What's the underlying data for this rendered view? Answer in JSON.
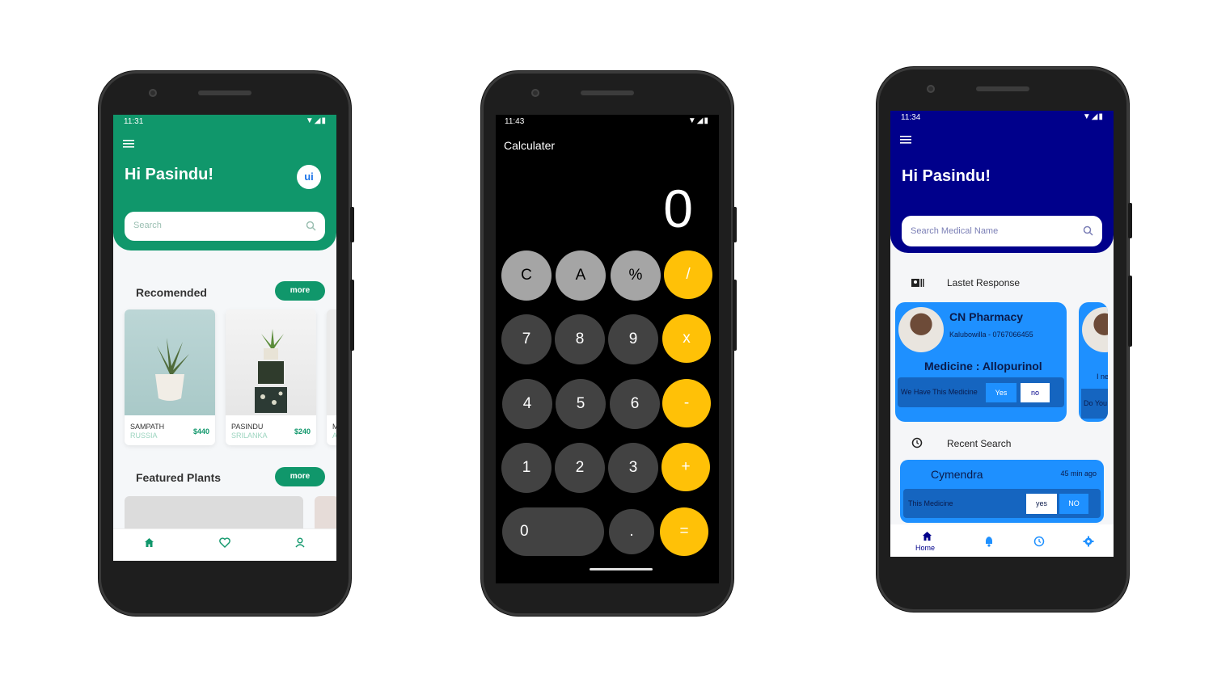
{
  "plants_app": {
    "status_time": "11:31",
    "greeting": "Hi Pasindu!",
    "search_placeholder": "Search",
    "recommended_title": "Recomended",
    "featured_title": "Featured Plants",
    "more_label": "more",
    "cards": [
      {
        "name": "SAMPATH",
        "country": "RUSSIA",
        "price": "$440"
      },
      {
        "name": "PASINDU",
        "country": "SRILANKA",
        "price": "$240"
      },
      {
        "name": "M",
        "country": "A",
        "price": ""
      }
    ],
    "accent_color": "#10976b"
  },
  "calculator_app": {
    "status_time": "11:43",
    "title": "Calculater",
    "display": "0",
    "keys": [
      [
        "C",
        "A",
        "%",
        "/"
      ],
      [
        "7",
        "8",
        "9",
        "x"
      ],
      [
        "4",
        "5",
        "6",
        "-"
      ],
      [
        "1",
        "2",
        "3",
        "+"
      ],
      [
        "0",
        ".",
        "="
      ]
    ],
    "operator_color": "#ffc107"
  },
  "pharmacy_app": {
    "status_time": "11:34",
    "greeting": "Hi Pasindu!",
    "search_placeholder": "Search Medical Name",
    "latest_label": "Lastet Response",
    "response": {
      "pharmacy": "CN Pharmacy",
      "address": "Kalubowilla - 0767066455",
      "medicine": "Medicine : Allopurinol",
      "question": "We Have This Medicine",
      "yes": "Yes",
      "no": "no"
    },
    "response_peek": {
      "text1": "I ne",
      "text2": "Do You"
    },
    "recent_label": "Recent Search",
    "recent": {
      "name": "Cymendra",
      "time_ago": "45 min ago",
      "question": "This Medicine",
      "yes": "yes",
      "no": "NO"
    },
    "nav_home_label": "Home",
    "accent_color": "#00008b",
    "card_color": "#1e90ff"
  }
}
